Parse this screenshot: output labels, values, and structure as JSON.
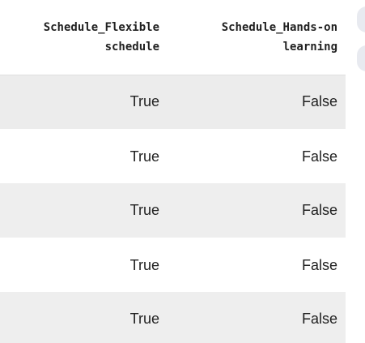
{
  "table": {
    "columns": [
      {
        "line1": "Schedule_Flexible",
        "line2": "schedule"
      },
      {
        "line1": "Schedule_Hands-on",
        "line2": "learning"
      }
    ],
    "rows": [
      [
        "True",
        "False"
      ],
      [
        "True",
        "False"
      ],
      [
        "True",
        "False"
      ],
      [
        "True",
        "False"
      ],
      [
        "True",
        "False"
      ]
    ]
  },
  "side_buttons": [
    "action-button-icon",
    "action-button-icon"
  ]
}
